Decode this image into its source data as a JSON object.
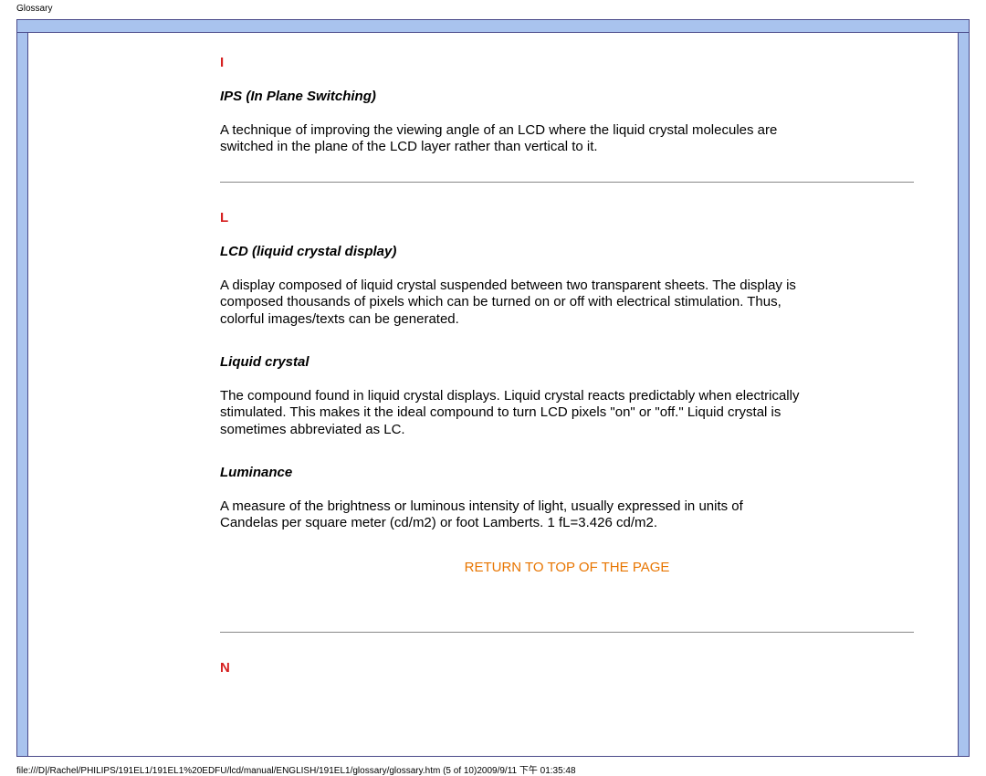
{
  "header_label": "Glossary",
  "sections": {
    "I": {
      "letter": "I",
      "terms": [
        {
          "name": "IPS (In Plane Switching)",
          "def": "A technique of improving the viewing angle of an LCD where the liquid crystal molecules are switched in the plane of the LCD layer rather than vertical to it."
        }
      ]
    },
    "L": {
      "letter": "L",
      "terms": [
        {
          "name": "LCD (liquid crystal display)",
          "def": "A display composed of liquid crystal suspended between two transparent sheets. The display is composed thousands of pixels which can be turned on or off with electrical stimulation. Thus, colorful images/texts can be generated."
        },
        {
          "name": "Liquid crystal",
          "def": "The compound found in liquid crystal displays. Liquid crystal reacts predictably when electrically stimulated. This makes it the ideal compound to turn LCD pixels \"on\" or \"off.\" Liquid crystal is sometimes abbreviated as LC."
        },
        {
          "name": "Luminance",
          "def": "A measure of the brightness or luminous intensity of light, usually expressed in units of Candelas per square meter (cd/m2) or foot Lamberts. 1 fL=3.426 cd/m2."
        }
      ]
    },
    "N": {
      "letter": "N"
    }
  },
  "return_link": "RETURN TO TOP OF THE PAGE",
  "footer": "file:///D|/Rachel/PHILIPS/191EL1/191EL1%20EDFU/lcd/manual/ENGLISH/191EL1/glossary/glossary.htm (5 of 10)2009/9/11 下午 01:35:48"
}
